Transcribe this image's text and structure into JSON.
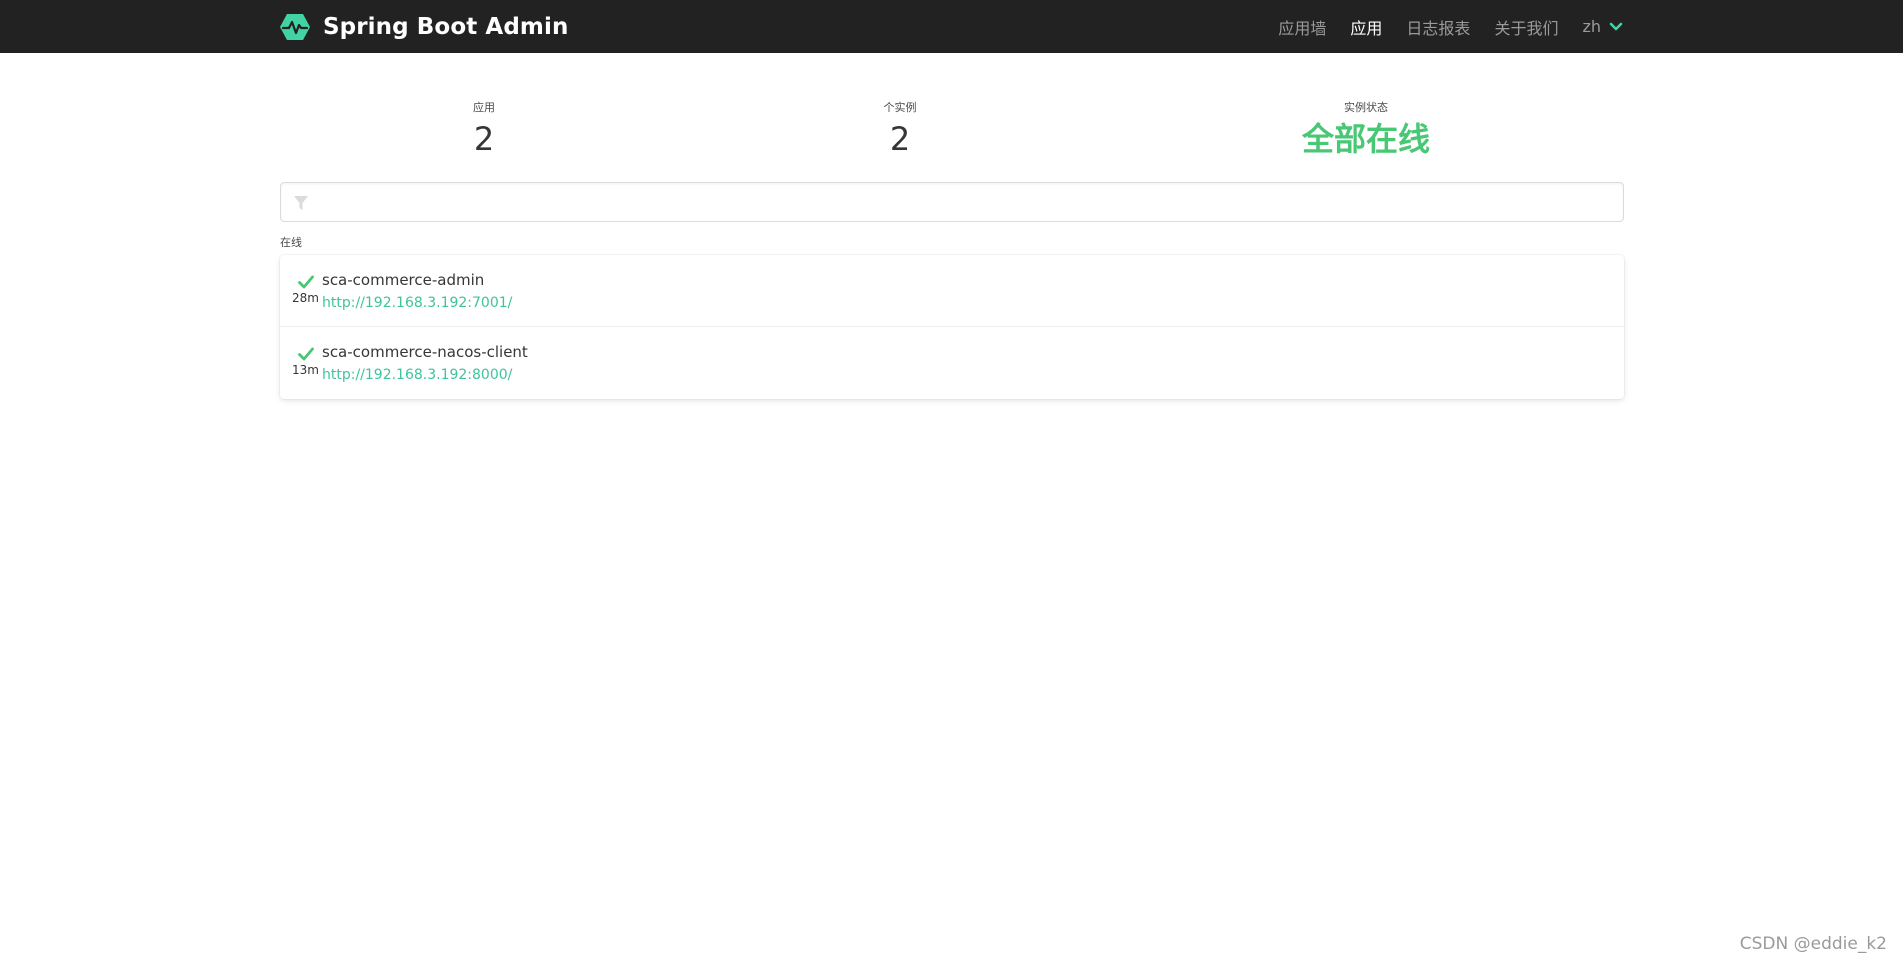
{
  "brand": {
    "title": "Spring Boot Admin"
  },
  "nav": {
    "items": [
      "应用墙",
      "应用",
      "日志报表",
      "关于我们"
    ],
    "active_index": 1,
    "lang": "zh"
  },
  "stats": {
    "apps_label": "应用",
    "apps_value": "2",
    "instances_label": "个实例",
    "instances_value": "2",
    "status_label": "实例状态",
    "status_value": "全部在线"
  },
  "filter": {
    "value": "",
    "placeholder": ""
  },
  "group": {
    "label": "在线",
    "apps": [
      {
        "name": "sca-commerce-admin",
        "uptime": "28m",
        "url": "http://192.168.3.192:7001/"
      },
      {
        "name": "sca-commerce-nacos-client",
        "uptime": "13m",
        "url": "http://192.168.3.192:8000/"
      }
    ]
  },
  "colors": {
    "navbar": "#222222",
    "accent": "#42d3a5",
    "status_up": "#48c774"
  },
  "watermark": "CSDN @eddie_k2"
}
